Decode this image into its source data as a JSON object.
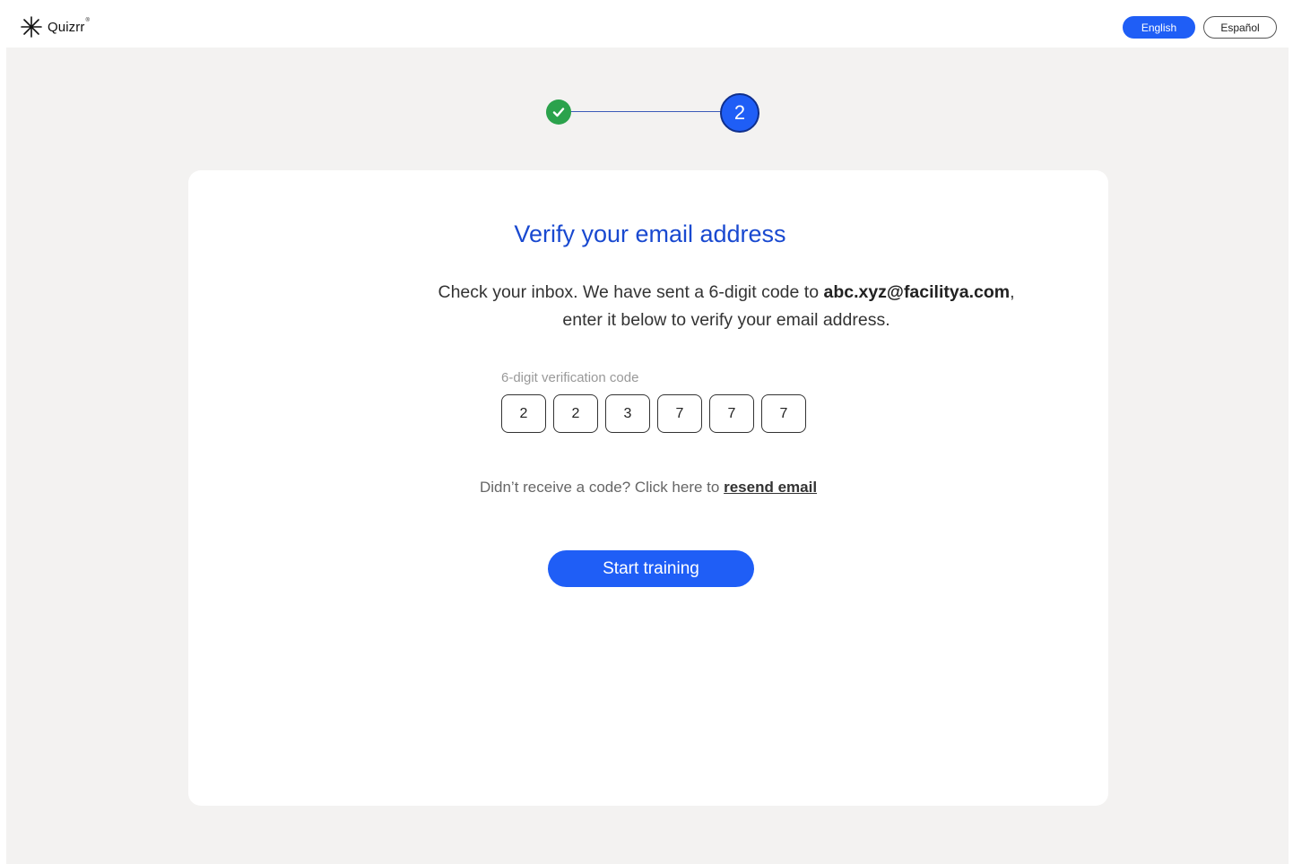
{
  "brand": {
    "name": "Quizrr",
    "registered_mark": "®"
  },
  "languages": {
    "english": "English",
    "spanish": "Español",
    "selected": "English"
  },
  "stepper": {
    "step1_status": "completed",
    "step2_number": "2"
  },
  "card": {
    "title": "Verify your email address",
    "desc_part1": "Check your inbox. We have sent a 6-digit code to ",
    "email": "abc.xyz@facilitya.com",
    "desc_part2": ",",
    "desc_line2": "enter it below to verify your email address.",
    "code_label": "6-digit verification code",
    "code_digits": [
      "2",
      "2",
      "3",
      "7",
      "7",
      "7"
    ],
    "resend_text": "Didn’t receive a code? Click here to ",
    "resend_link": "resend email",
    "start_button": "Start training"
  },
  "colors": {
    "primary": "#1f5ef6",
    "title": "#1949d0",
    "success": "#2ba24c",
    "background": "#f3f2f1"
  },
  "icons": {
    "logo": "asterisk-logo-icon",
    "done": "checkmark-icon"
  }
}
